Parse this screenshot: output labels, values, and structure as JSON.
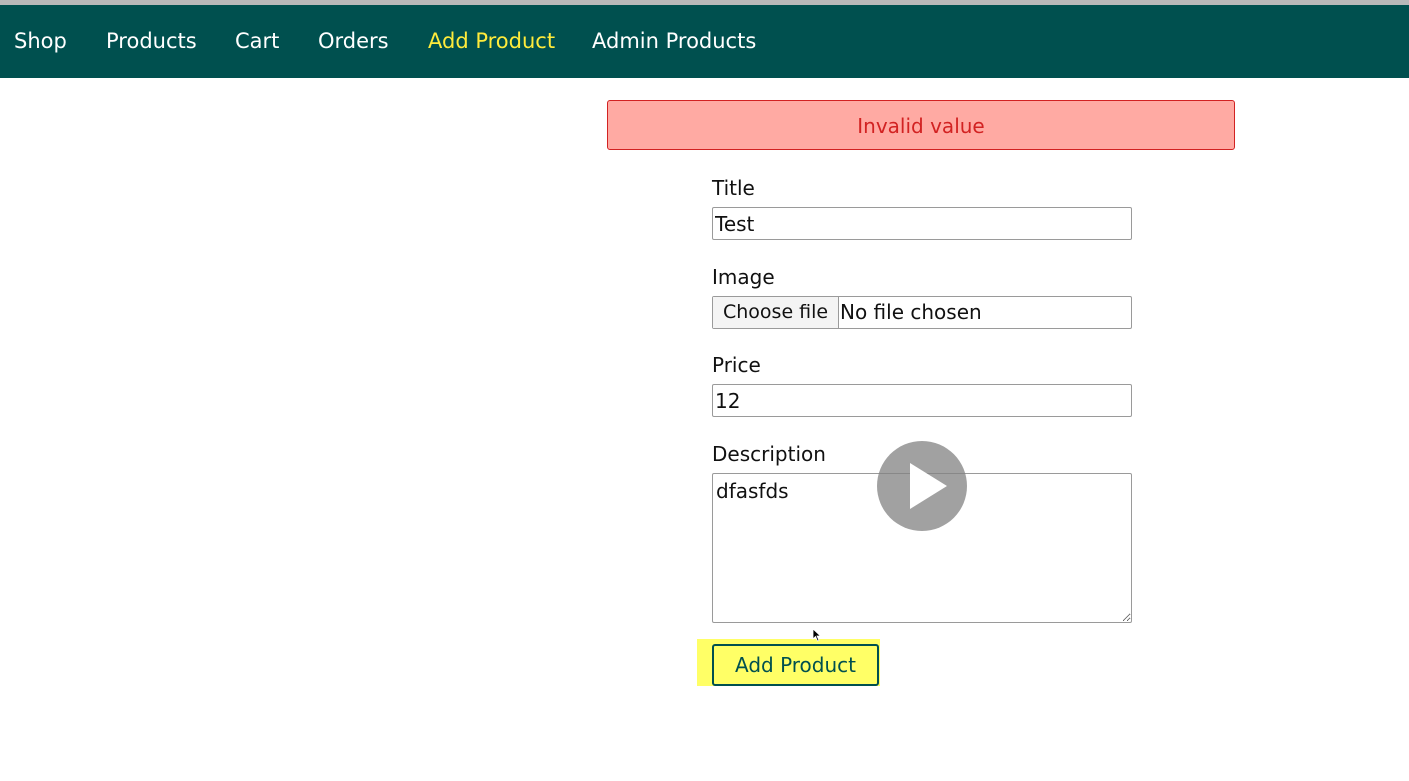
{
  "nav": {
    "items": [
      {
        "label": "Shop"
      },
      {
        "label": "Products"
      },
      {
        "label": "Cart"
      },
      {
        "label": "Orders"
      },
      {
        "label": "Add Product",
        "active": true
      },
      {
        "label": "Admin Products"
      }
    ],
    "active_color": "#ffeb3b",
    "background": "#00504f"
  },
  "error": {
    "message": "Invalid value"
  },
  "form": {
    "title_label": "Title",
    "title_value": "Test",
    "image_label": "Image",
    "file_button_label": "Choose file",
    "file_status": "No file chosen",
    "price_label": "Price",
    "price_value": "12",
    "description_label": "Description",
    "description_value": "dfasfds",
    "submit_label": "Add Product"
  },
  "overlay": {
    "icon": "play-icon"
  }
}
